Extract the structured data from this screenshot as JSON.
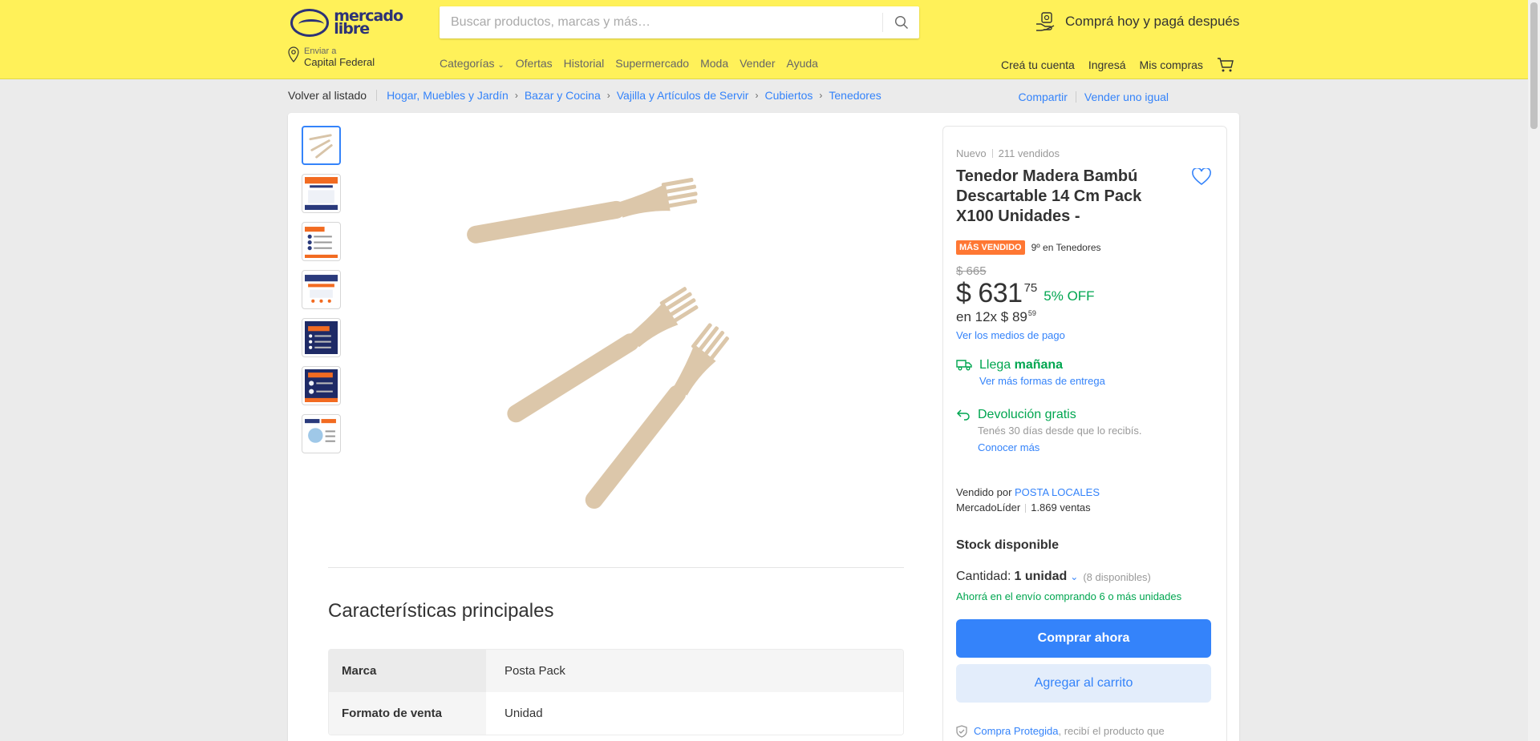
{
  "header": {
    "logo_text_1": "mercado",
    "logo_text_2": "libre",
    "search_placeholder": "Buscar productos, marcas y más…",
    "promo": "Comprá hoy y pagá después",
    "location_label": "Enviar a",
    "location_value": "Capital Federal",
    "nav": [
      "Categorías",
      "Ofertas",
      "Historial",
      "Supermercado",
      "Moda",
      "Vender",
      "Ayuda"
    ],
    "user_nav": [
      "Creá tu cuenta",
      "Ingresá",
      "Mis compras"
    ]
  },
  "breadcrumb": {
    "back": "Volver al listado",
    "items": [
      "Hogar, Muebles y Jardín",
      "Bazar y Cocina",
      "Vajilla y Artículos de Servir",
      "Cubiertos",
      "Tenedores"
    ],
    "share": "Compartir",
    "sell_same": "Vender uno igual"
  },
  "product": {
    "condition": "Nuevo",
    "sold": "211 vendidos",
    "title": "Tenedor Madera Bambú Descartable 14 Cm Pack X100 Unidades -",
    "badge": "MÁS VENDIDO",
    "rank": "9º en Tenedores",
    "old_price": "$ 665",
    "price": "$ 631",
    "price_cents": "75",
    "discount": "5% OFF",
    "installments_prefix": "en 12x $ 89",
    "installments_cents": "59",
    "payment_link": "Ver los medios de pago",
    "shipping_prefix": "Llega ",
    "shipping_bold": "mañana",
    "shipping_link": "Ver más formas de entrega",
    "return_title": "Devolución gratis",
    "return_desc": "Tenés 30 días desde que lo recibís.",
    "return_link": "Conocer más",
    "seller_prefix": "Vendido por ",
    "seller_name": "POSTA LOCALES",
    "seller_level": "MercadoLíder",
    "seller_sales": "1.869 ventas",
    "stock": "Stock disponible",
    "qty_label": "Cantidad:",
    "qty_value": "1 unidad",
    "qty_available": "(8 disponibles)",
    "saving": "Ahorrá en el envío comprando 6 o más unidades",
    "buy_now": "Comprar ahora",
    "add_cart": "Agregar al carrito",
    "protected_name": "Compra Protegida",
    "protected_text": ", recibí el producto que"
  },
  "specs": {
    "title": "Características principales",
    "rows": [
      {
        "key": "Marca",
        "value": "Posta Pack"
      },
      {
        "key": "Formato de venta",
        "value": "Unidad"
      }
    ]
  },
  "colors": {
    "header_bg": "#fff159",
    "accent": "#3483fa",
    "green": "#00a650",
    "badge": "#ff7733"
  }
}
